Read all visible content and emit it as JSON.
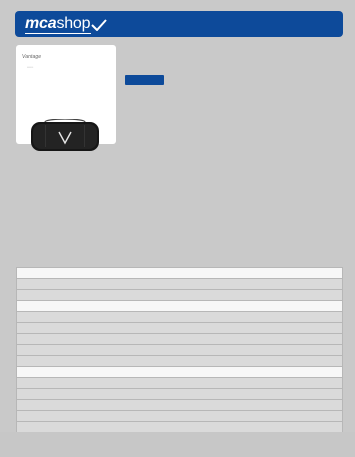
{
  "header": {
    "logo_bold": "mca",
    "logo_light": "shop",
    "bg_color": "#0d4a9a"
  },
  "product": {
    "brand": "Vantage",
    "image_icon": "camera-bag-icon"
  },
  "table": {
    "rows": [
      "white",
      "gray",
      "gray",
      "white",
      "gray",
      "gray",
      "gray",
      "gray",
      "gray",
      "white",
      "gray",
      "gray",
      "gray",
      "gray",
      "gray"
    ]
  }
}
